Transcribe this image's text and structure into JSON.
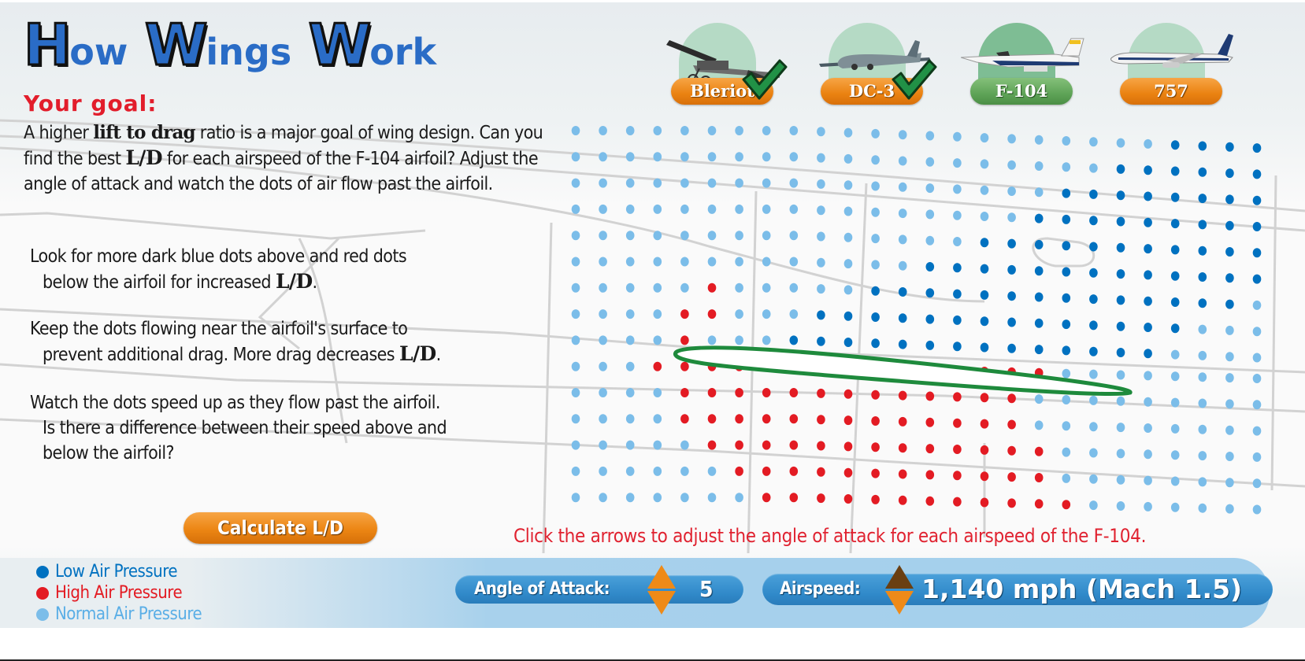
{
  "title": {
    "words": [
      {
        "cap": "H",
        "rest": "ow"
      },
      {
        "cap": "W",
        "rest": "ings"
      },
      {
        "cap": "W",
        "rest": "ork"
      }
    ]
  },
  "planes": [
    {
      "name": "Bleriot",
      "completed": true,
      "active": false
    },
    {
      "name": "DC-3",
      "completed": true,
      "active": false
    },
    {
      "name": "F-104",
      "completed": false,
      "active": true
    },
    {
      "name": "757",
      "completed": false,
      "active": false
    }
  ],
  "goal": {
    "heading": "Your goal:",
    "intro_1": "A higher ",
    "intro_bold": "lift to drag",
    "intro_2": " ratio is a major goal of wing design. Can you find the best ",
    "ld": "L/D",
    "intro_3": " for each airspeed of the F-104 airfoil? Adjust the angle of attack and watch the dots of air flow past the airfoil.",
    "tip1_line1": "Look for more dark blue dots above and red dots",
    "tip1_line2": "below the airfoil for increased ",
    "tip1_end": ".",
    "tip2_line1": "Keep the dots flowing near the airfoil's surface to",
    "tip2_line2": "prevent additional drag. More drag decreases ",
    "tip2_end": ".",
    "tip3_line1": "Watch the dots speed up as they flow past the airfoil.",
    "tip3_line2": "Is there a difference between their speed above and",
    "tip3_line3": "below the airfoil?"
  },
  "calculate_button": "Calculate L/D",
  "instruction": "Click the arrows to adjust the angle of attack for each airspeed of the F-104.",
  "legend": [
    {
      "label": "Low Air Pressure",
      "color": "#0071c0"
    },
    {
      "label": "High Air Pressure",
      "color": "#e31b23"
    },
    {
      "label": "Normal Air Pressure",
      "color": "#7bbde9"
    }
  ],
  "controls": {
    "angle_label": "Angle of Attack:",
    "angle_value": "5",
    "airspeed_label": "Airspeed:",
    "airspeed_value": "1,140 mph (Mach 1.5)",
    "airspeed_up_enabled": false
  },
  "colors": {
    "low": "#0071c0",
    "high": "#e31b23",
    "normal": "#7bbde9",
    "airfoil": "#1e8a3c",
    "accent_orange": "#ec8614",
    "accent_green": "#5ea357",
    "instruction_red": "#e02230"
  },
  "flow_field": {
    "rows": [
      "NNNNNNNNNNNNNNNNNNNNNNLLLL",
      "NNNNNNNNNNNNNNNNNNNNLLLLLL",
      "NNNNNNNNNNNNNNNNNNLLLLLLLL",
      "NNNNNNNNNNNNNNNNNLLLLLLLLL",
      "NNNNNNNNNNNNNNNLLLLLLLLLLL",
      "NNNNNNNNNNNNNLLLLLLLLLLLLL",
      "NNNNNHNNNNNLLLLLLLLLLLLLLN",
      "NNNNHHNNNLLLLLLLLLLLLLLNNN",
      "NNNNHNNNLLLLLLLLLLLLLLNNNN",
      "NNNHHHHHHHHHHHHHHHNNNNNNNN",
      "NNNNHHHHHHHHHHHHHNNNNNNNNN",
      "NNNNHHHHHHHHHHHHHNNNNNNNNN",
      "NNNNNHHHHHHHHHHHHHNNNNNNNN",
      "NNNNNNHHHHHHHHHHHHNNNNNNNN",
      "NNNNNNNHHHHHHHHHHHHNNNNNNN"
    ],
    "legend_key": {
      "L": "low",
      "H": "high",
      "N": "normal"
    }
  }
}
